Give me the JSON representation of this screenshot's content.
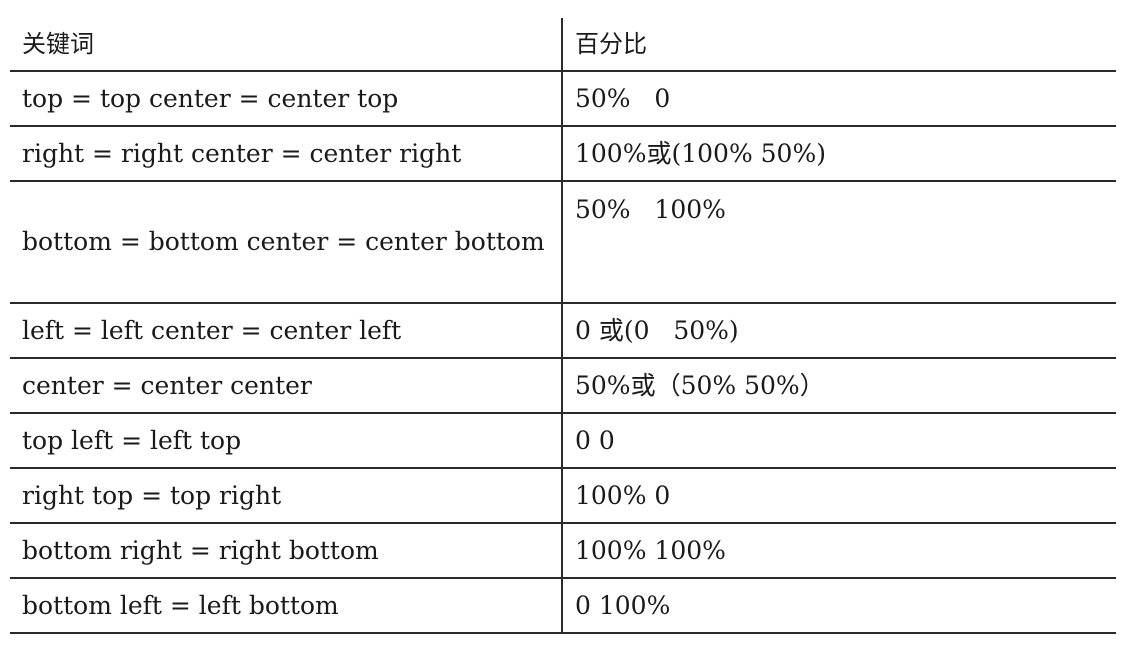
{
  "table": {
    "headers": {
      "keyword": "关键词",
      "percent": "百分比"
    },
    "rows": [
      {
        "keyword": "top = top center = center top",
        "percent": "50%   0"
      },
      {
        "keyword": "right = right center = center right",
        "percent": "100%或(100% 50%)"
      },
      {
        "keyword": "bottom = bottom center = center bottom",
        "percent": "50%   100%"
      },
      {
        "keyword": "left = left center = center left",
        "percent": "0 或(0   50%)"
      },
      {
        "keyword": "center = center center",
        "percent": "50%或（50% 50%）"
      },
      {
        "keyword": "top left = left top",
        "percent": "0 0"
      },
      {
        "keyword": "right top = top right",
        "percent": "100% 0"
      },
      {
        "keyword": "bottom right = right bottom",
        "percent": "100% 100%"
      },
      {
        "keyword": "bottom left = left bottom",
        "percent": "0 100%"
      }
    ]
  }
}
